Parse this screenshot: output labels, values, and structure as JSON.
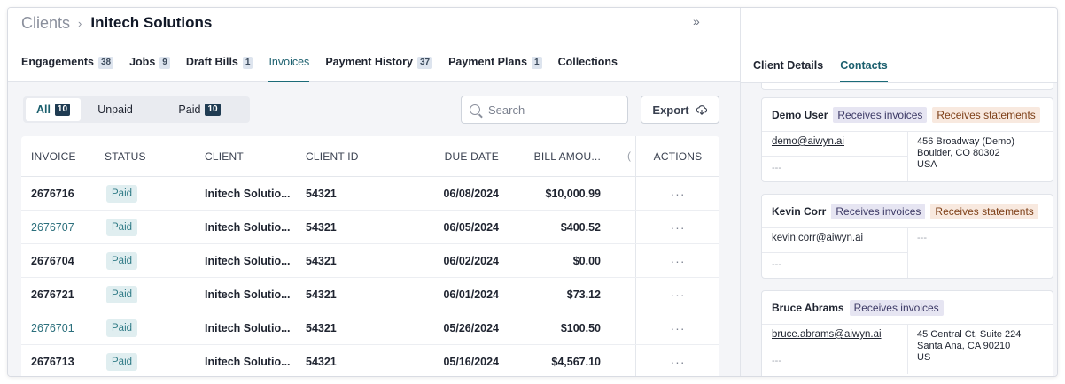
{
  "breadcrumb": {
    "root": "Clients",
    "separator": "›",
    "current": "Initech Solutions"
  },
  "collapse_icon": "»",
  "tabs": [
    {
      "label": "Engagements",
      "badge": "38"
    },
    {
      "label": "Jobs",
      "badge": "9"
    },
    {
      "label": "Draft Bills",
      "badge": "1"
    },
    {
      "label": "Invoices",
      "badge": ""
    },
    {
      "label": "Payment History",
      "badge": "37"
    },
    {
      "label": "Payment Plans",
      "badge": "1"
    },
    {
      "label": "Collections",
      "badge": ""
    }
  ],
  "filter": {
    "all_label": "All",
    "all_count": "10",
    "unpaid_label": "Unpaid",
    "paid_label": "Paid",
    "paid_count": "10"
  },
  "search": {
    "placeholder": "Search",
    "value": ""
  },
  "export": {
    "label": "Export"
  },
  "table": {
    "headers": {
      "invoice": "INVOICE",
      "status": "STATUS",
      "client": "CLIENT",
      "client_id": "CLIENT ID",
      "due_date": "DUE DATE",
      "bill_amount": "BILL AMOU...",
      "cut": "(",
      "actions": "ACTIONS"
    },
    "rows": [
      {
        "invoice": "2676716",
        "status": "Paid",
        "client": "Initech Solutio...",
        "client_id": "54321",
        "due": "06/08/2024",
        "amount": "$10,000.99",
        "actions": "···"
      },
      {
        "invoice": "2676707",
        "status": "Paid",
        "client": "Initech Solutio...",
        "client_id": "54321",
        "due": "06/05/2024",
        "amount": "$400.52",
        "actions": "···"
      },
      {
        "invoice": "2676704",
        "status": "Paid",
        "client": "Initech Solutio...",
        "client_id": "54321",
        "due": "06/02/2024",
        "amount": "$0.00",
        "actions": "···"
      },
      {
        "invoice": "2676721",
        "status": "Paid",
        "client": "Initech Solutio...",
        "client_id": "54321",
        "due": "06/01/2024",
        "amount": "$73.12",
        "actions": "···"
      },
      {
        "invoice": "2676701",
        "status": "Paid",
        "client": "Initech Solutio...",
        "client_id": "54321",
        "due": "05/26/2024",
        "amount": "$100.50",
        "actions": "···"
      },
      {
        "invoice": "2676713",
        "status": "Paid",
        "client": "Initech Solutio...",
        "client_id": "54321",
        "due": "05/16/2024",
        "amount": "$4,567.10",
        "actions": "···"
      }
    ]
  },
  "right_tabs": [
    {
      "label": "Client Details"
    },
    {
      "label": "Contacts"
    }
  ],
  "contacts": [
    {
      "name": "Demo User",
      "tag_invoices": "Receives invoices",
      "tag_statements": "Receives statements",
      "email": "demo@aiwyn.ai",
      "phone": "---",
      "address_line1": "456 Broadway (Demo)",
      "address_line2": "Boulder, CO 80302",
      "address_line3": "USA"
    },
    {
      "name": "Kevin Corr",
      "tag_invoices": "Receives invoices",
      "tag_statements": "Receives statements",
      "email": "kevin.corr@aiwyn.ai",
      "phone": "---",
      "address_line1": "---"
    },
    {
      "name": "Bruce Abrams",
      "tag_invoices": "Receives invoices",
      "email": "bruce.abrams@aiwyn.ai",
      "phone": "---",
      "address_line1": "45 Central Ct, Suite 224",
      "address_line2": "Santa Ana, CA 90210",
      "address_line3": "US"
    }
  ]
}
